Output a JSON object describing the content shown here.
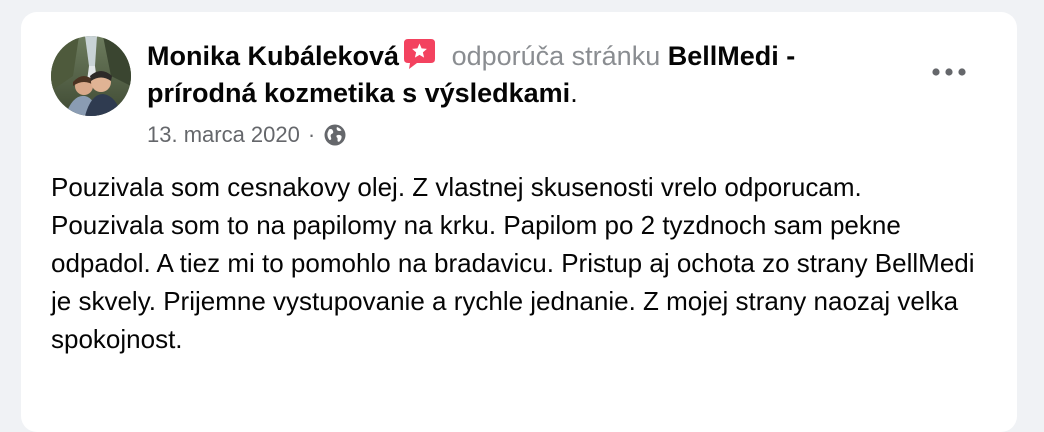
{
  "post": {
    "author": "Monika Kubáleková",
    "verb": " odporúča stránku ",
    "page_name": "BellMedi - prírodná kozmetika s výsledkami",
    "period": ".",
    "date": "13. marca 2020",
    "separator": "·",
    "text": "Pouzivala som cesnakovy olej. Z vlastnej skusenosti vrelo odporucam. Pouzivala som to na papilomy na krku. Papilom po 2 tyzdnoch sam pekne odpadol. A tiez mi to pomohlo na bradavicu. Pristup aj ochota zo strany BellMedi je skvely. Prijemne vystupovanie a rychle jednanie. Z mojej strany naozaj velka spokojnost.",
    "icons": {
      "recommend": "recommend-star-icon",
      "privacy": "globe-icon",
      "more": "more-options-icon"
    }
  },
  "colors": {
    "background": "#f0f2f5",
    "card": "#ffffff",
    "primary_text": "#050505",
    "secondary_text": "#65676b",
    "recommend_badge": "#f3425f"
  }
}
